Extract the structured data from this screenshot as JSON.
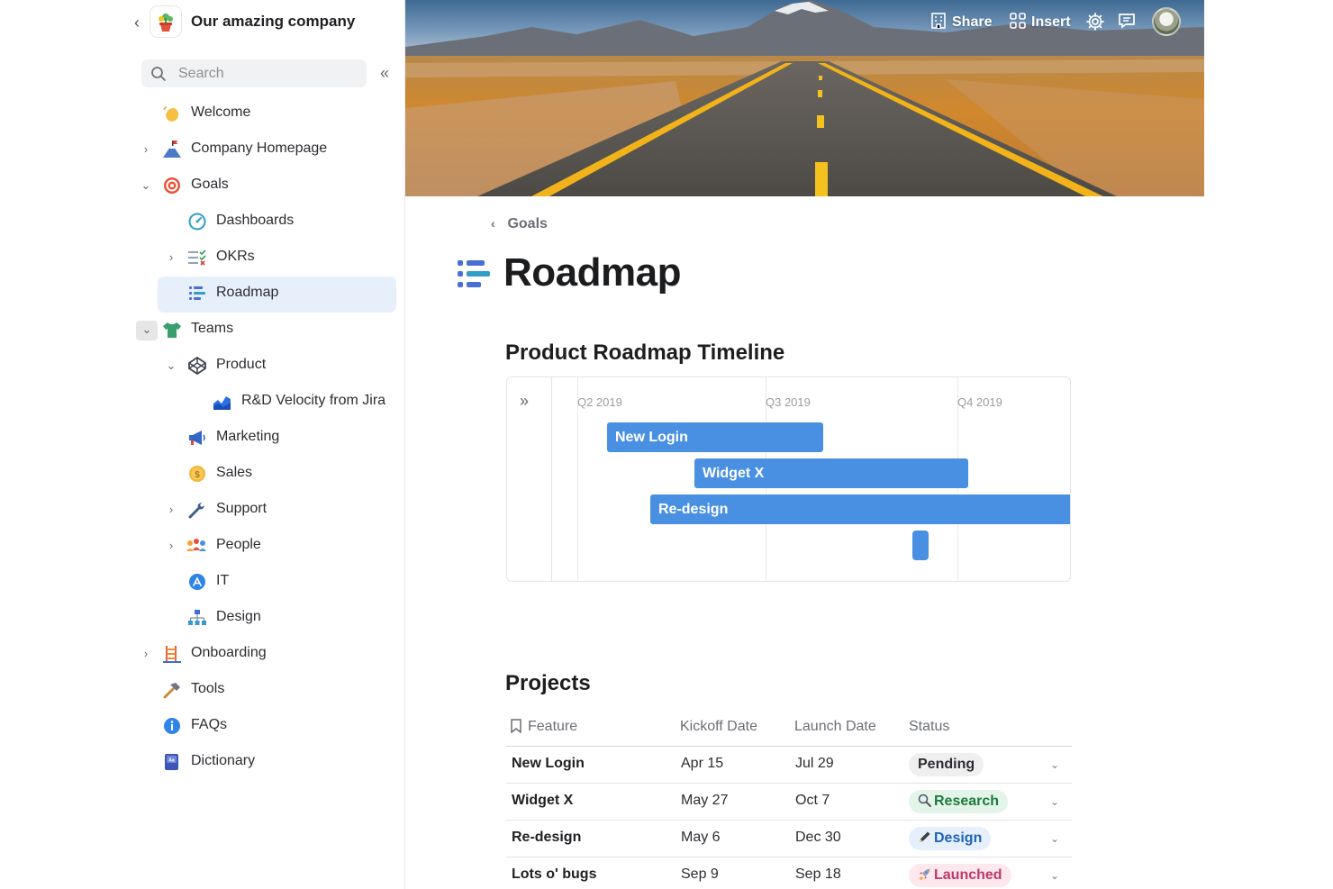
{
  "workspace": {
    "title": "Our amazing company"
  },
  "search": {
    "placeholder": "Search"
  },
  "sidebar": {
    "items": [
      {
        "label": "Welcome",
        "icon": "waving-hand-icon"
      },
      {
        "label": "Company Homepage",
        "icon": "mountain-flag-icon"
      },
      {
        "label": "Goals",
        "icon": "target-icon"
      },
      {
        "label": "Dashboards",
        "icon": "speedometer-icon"
      },
      {
        "label": "OKRs",
        "icon": "checklist-icon"
      },
      {
        "label": "Roadmap",
        "icon": "roadmap-icon"
      },
      {
        "label": "Teams",
        "icon": "tshirt-icon"
      },
      {
        "label": "Product",
        "icon": "codepen-icon"
      },
      {
        "label": "R&D Velocity from Jira",
        "icon": "area-chart-icon"
      },
      {
        "label": "Marketing",
        "icon": "megaphone-icon"
      },
      {
        "label": "Sales",
        "icon": "coin-icon"
      },
      {
        "label": "Support",
        "icon": "wrench-icon"
      },
      {
        "label": "People",
        "icon": "people-icon"
      },
      {
        "label": "IT",
        "icon": "app-store-icon"
      },
      {
        "label": "Design",
        "icon": "hierarchy-icon"
      },
      {
        "label": "Onboarding",
        "icon": "ladder-icon"
      },
      {
        "label": "Tools",
        "icon": "hammer-icon"
      },
      {
        "label": "FAQs",
        "icon": "info-icon"
      },
      {
        "label": "Dictionary",
        "icon": "dictionary-icon"
      }
    ]
  },
  "topbar": {
    "share": "Share",
    "insert": "Insert"
  },
  "breadcrumb": {
    "parent": "Goals"
  },
  "page": {
    "title": "Roadmap"
  },
  "timeline": {
    "heading": "Product Roadmap Timeline",
    "quarters": [
      "Q2 2019",
      "Q3 2019",
      "Q4 2019"
    ],
    "bars": [
      {
        "label": "New Login"
      },
      {
        "label": "Widget X"
      },
      {
        "label": "Re-design"
      }
    ]
  },
  "projects": {
    "heading": "Projects",
    "columns": [
      "Feature",
      "Kickoff Date",
      "Launch Date",
      "Status"
    ],
    "rows": [
      {
        "feature": "New Login",
        "kickoff": "Apr 15",
        "launch": "Jul 29",
        "status": "Pending",
        "status_icon": ""
      },
      {
        "feature": "Widget X",
        "kickoff": "May 27",
        "launch": "Oct 7",
        "status": "Research",
        "status_icon": "magnifier-icon"
      },
      {
        "feature": "Re-design",
        "kickoff": "May 6",
        "launch": "Dec 30",
        "status": "Design",
        "status_icon": "pencil-icon"
      },
      {
        "feature": "Lots o' bugs",
        "kickoff": "Sep 9",
        "launch": "Sep 18",
        "status": "Launched",
        "status_icon": "rocket-icon"
      }
    ]
  },
  "colors": {
    "accent": "#4a90e2",
    "selected_bg": "#e7f0fa",
    "pending_bg": "#efefef",
    "research_bg": "#e3f5e8",
    "research_fg": "#1e7a3a",
    "design_bg": "#e5f0fc",
    "design_fg": "#1f63b8",
    "launched_bg": "#fde8ee",
    "launched_fg": "#c0366a"
  }
}
